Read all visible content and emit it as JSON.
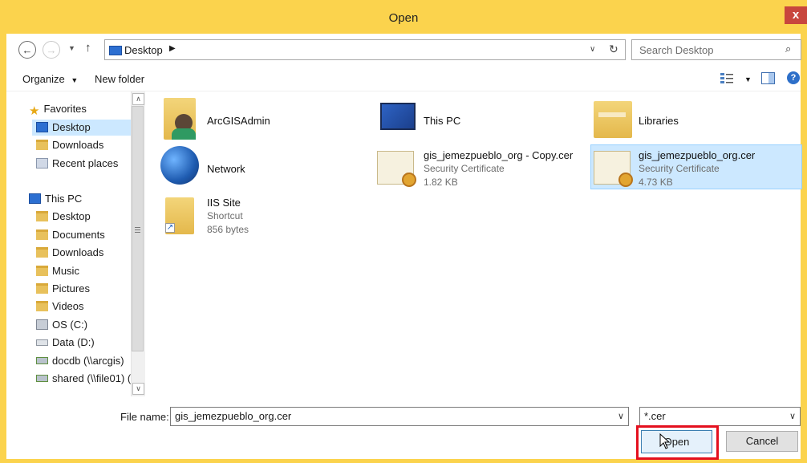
{
  "window": {
    "title": "Open",
    "close_glyph": "x"
  },
  "nav": {
    "back_icon": "back-arrow-icon",
    "forward_icon": "forward-arrow-icon",
    "up_icon": "up-arrow-icon",
    "breadcrumb": "Desktop",
    "search_placeholder": "Search Desktop"
  },
  "toolbar": {
    "organize": "Organize",
    "new_folder": "New folder"
  },
  "sidebar": {
    "favorites": "Favorites",
    "fav_items": [
      "Desktop",
      "Downloads",
      "Recent places"
    ],
    "this_pc": "This PC",
    "pc_items": [
      "Desktop",
      "Documents",
      "Downloads",
      "Music",
      "Pictures",
      "Videos",
      "OS (C:)",
      "Data (D:)",
      "docdb (\\\\arcgis)",
      "shared (\\\\file01) ("
    ]
  },
  "files": [
    {
      "name": "ArcGISAdmin",
      "sub1": "",
      "sub2": ""
    },
    {
      "name": "This PC",
      "sub1": "",
      "sub2": ""
    },
    {
      "name": "Libraries",
      "sub1": "",
      "sub2": ""
    },
    {
      "name": "Network",
      "sub1": "",
      "sub2": ""
    },
    {
      "name": "gis_jemezpueblo_org - Copy.cer",
      "sub1": "Security Certificate",
      "sub2": "1.82 KB"
    },
    {
      "name": "gis_jemezpueblo_org.cer",
      "sub1": "Security Certificate",
      "sub2": "4.73 KB"
    },
    {
      "name": "IIS Site",
      "sub1": "Shortcut",
      "sub2": "856 bytes"
    }
  ],
  "bottom": {
    "filename_label": "File name:",
    "filename_value": "gis_jemezpueblo_org.cer",
    "filetype_value": "*.cer",
    "open_label": "Open",
    "cancel_label": "Cancel"
  },
  "colors": {
    "frame": "#fbd34d",
    "selection": "#cce8ff",
    "highlight_outline": "#e4101e"
  }
}
